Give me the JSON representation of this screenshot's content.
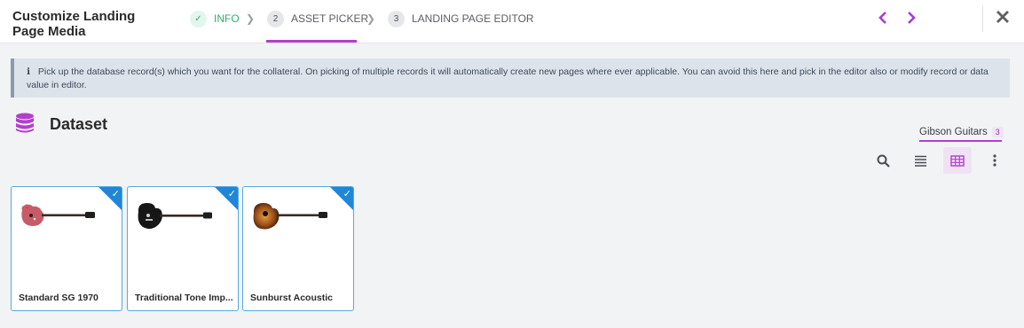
{
  "header": {
    "title": "Customize Landing Page Media",
    "steps": [
      {
        "number": "✓",
        "label": "INFO",
        "state": "done"
      },
      {
        "number": "2",
        "label": "ASSET PICKER",
        "state": "active"
      },
      {
        "number": "3",
        "label": "LANDING PAGE EDITOR",
        "state": "pending"
      }
    ],
    "prev_icon": "chevron-left-icon",
    "next_icon": "chevron-right-icon",
    "close_icon": "close-icon"
  },
  "info_banner": {
    "icon": "info-icon",
    "text": "Pick up the database record(s) which you want for the collateral. On picking of multiple records it will automatically create new pages where ever applicable. You can avoid this here and pick in the editor also or modify record or data value in editor."
  },
  "dataset": {
    "icon": "database-icon",
    "title": "Dataset",
    "tabs": [
      {
        "label": "Gibson Guitars",
        "count": "3"
      }
    ],
    "toolbar": [
      "search-icon",
      "list-view-icon",
      "grid-view-icon",
      "more-vert-icon"
    ],
    "records": [
      {
        "name": "Standard SG 1970",
        "selected": true,
        "thumb": "red-sg-guitar"
      },
      {
        "name": "Traditional Tone Imp...",
        "selected": true,
        "thumb": "black-semi-hollow-guitar"
      },
      {
        "name": "Sunburst Acoustic",
        "selected": true,
        "thumb": "sunburst-acoustic-guitar"
      }
    ]
  },
  "colors": {
    "accent": "#b33ecc",
    "done": "#2fae6d",
    "selection": "#1f86d9",
    "banner_bg": "#dde3ea"
  }
}
